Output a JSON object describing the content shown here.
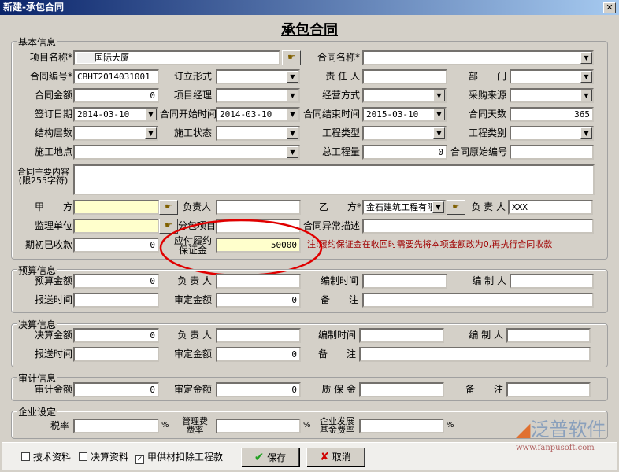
{
  "window": {
    "title": "新建-承包合同",
    "close_icon": "close-icon"
  },
  "form_title": "承包合同",
  "basic": {
    "title": "基本信息",
    "project_name": {
      "label": "项目名称*",
      "value": "国际大厦"
    },
    "contract_name": {
      "label": "合同名称*",
      "value": ""
    },
    "contract_no": {
      "label": "合同编号*",
      "value": "CBHT2014031001"
    },
    "form_type": {
      "label": "订立形式",
      "value": ""
    },
    "responsible": {
      "label": "责 任 人",
      "value": ""
    },
    "department": {
      "label": "部　　门",
      "value": ""
    },
    "amount": {
      "label": "合同金额",
      "value": "0"
    },
    "manager": {
      "label": "项目经理",
      "value": ""
    },
    "operation": {
      "label": "经营方式",
      "value": ""
    },
    "purchase_source": {
      "label": "采购来源",
      "value": ""
    },
    "sign_date": {
      "label": "签订日期",
      "value": "2014-03-10"
    },
    "start_date": {
      "label": "合同开始时间",
      "value": "2014-03-10"
    },
    "end_date": {
      "label": "合同结束时间",
      "value": "2015-03-10"
    },
    "days": {
      "label": "合同天数",
      "value": "365"
    },
    "floors": {
      "label": "结构层数",
      "value": ""
    },
    "status": {
      "label": "施工状态",
      "value": ""
    },
    "project_type": {
      "label": "工程类型",
      "value": ""
    },
    "project_category": {
      "label": "工程类别",
      "value": ""
    },
    "site": {
      "label": "施工地点",
      "value": ""
    },
    "total_qty": {
      "label": "总工程量",
      "value": "0"
    },
    "original_no": {
      "label": "合同原始编号",
      "value": ""
    },
    "content": {
      "label1": "合同主要内容",
      "label2": "(限255字符)",
      "value": ""
    },
    "party_a": {
      "label": "甲　　方",
      "value": ""
    },
    "party_a_person": {
      "label": "负责人",
      "value": ""
    },
    "party_b": {
      "label": "乙　　方*",
      "value": "金石建筑工程有限公"
    },
    "party_b_person": {
      "label": "负 责 人",
      "value": "XXX"
    },
    "supervisor": {
      "label": "监理单位",
      "value": ""
    },
    "subcontract": {
      "label": "分包项目",
      "value": ""
    },
    "exception": {
      "label": "合同异常描述",
      "value": ""
    },
    "received": {
      "label": "期初已收款",
      "value": "0"
    },
    "deposit": {
      "label1": "应付履约",
      "label2": "保证金",
      "value": "50000"
    },
    "note": "注:履约保证金在收回时需要先将本项金额改为0,再执行合同收款"
  },
  "budget": {
    "title": "预算信息",
    "amount": {
      "label": "预算金额",
      "value": "0"
    },
    "person": {
      "label": "负 责 人",
      "value": ""
    },
    "made_time": {
      "label": "编制时间",
      "value": ""
    },
    "maker": {
      "label": "编 制 人",
      "value": ""
    },
    "send_time": {
      "label": "报送时间",
      "value": ""
    },
    "approved": {
      "label": "审定金额",
      "value": "0"
    },
    "remark": {
      "label": "备　　注",
      "value": ""
    }
  },
  "final": {
    "title": "决算信息",
    "amount": {
      "label": "决算金额",
      "value": "0"
    },
    "person": {
      "label": "负 责 人",
      "value": ""
    },
    "made_time": {
      "label": "编制时间",
      "value": ""
    },
    "maker": {
      "label": "编 制 人",
      "value": ""
    },
    "send_time": {
      "label": "报送时间",
      "value": ""
    },
    "approved": {
      "label": "审定金额",
      "value": "0"
    },
    "remark": {
      "label": "备　　注",
      "value": ""
    }
  },
  "audit": {
    "title": "审计信息",
    "amount": {
      "label": "审计金额",
      "value": "0"
    },
    "approved": {
      "label": "审定金额",
      "value": "0"
    },
    "warranty": {
      "label": "质 保 金",
      "value": ""
    },
    "remark": {
      "label": "备　　注",
      "value": ""
    }
  },
  "enterprise": {
    "title": "企业设定",
    "tax": {
      "label": "税率",
      "value": "",
      "unit": "%"
    },
    "mgmt": {
      "label1": "管理费",
      "label2": "费率",
      "value": "",
      "unit": "%"
    },
    "fund": {
      "label1": "企业发展",
      "label2": "基金费率",
      "value": "",
      "unit": "%"
    }
  },
  "footer": {
    "checks": [
      {
        "label": "技术资料",
        "checked": false
      },
      {
        "label": "决算资料",
        "checked": false
      },
      {
        "label": "甲供材扣除工程款",
        "checked": true
      }
    ],
    "save": "保存",
    "cancel": "取消",
    "logo_text": "泛普软件",
    "logo_url": "www.fanpusoft.com"
  },
  "colors": {
    "highlight_ellipse": "#e00000",
    "required_yellow": "#ffffcc",
    "note_text": "#a00000"
  }
}
